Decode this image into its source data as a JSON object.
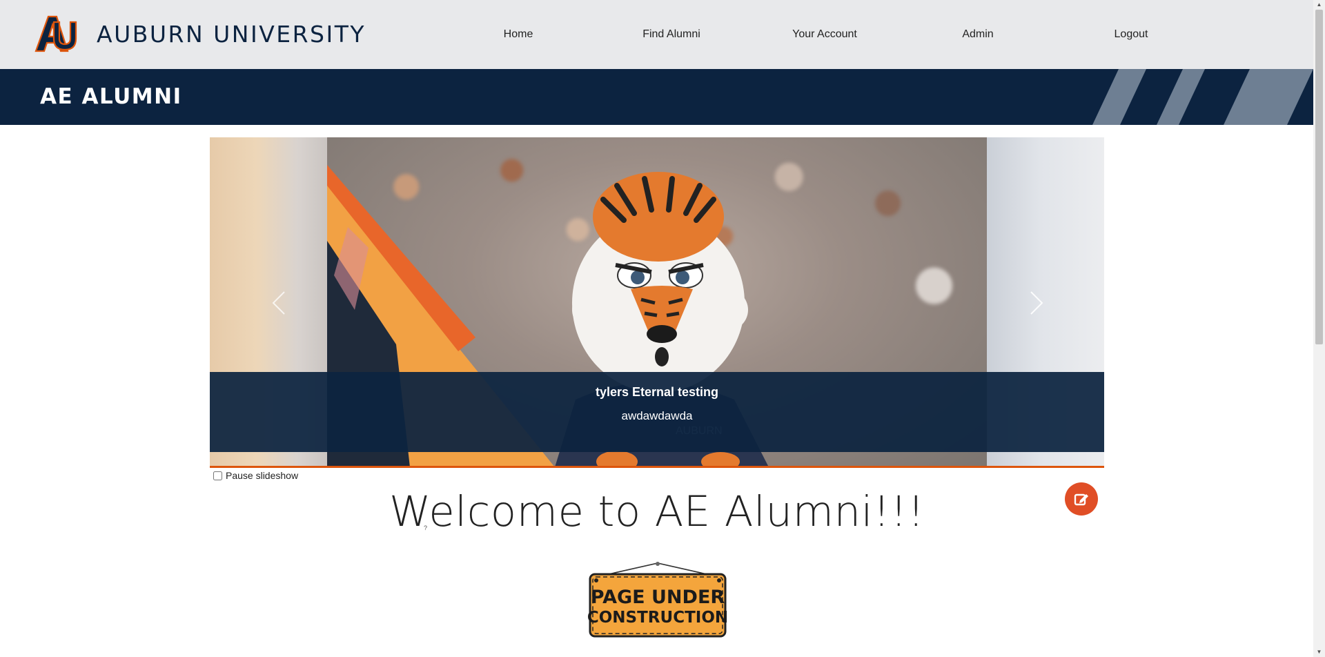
{
  "header": {
    "university_name": "AUBURN UNIVERSITY",
    "logo_icon": "au-logo-icon",
    "brand_colors": {
      "navy": "#0c2340",
      "orange": "#dd550c"
    },
    "nav": [
      {
        "label": "Home"
      },
      {
        "label": "Find Alumni"
      },
      {
        "label": "Your Account"
      },
      {
        "label": "Admin"
      },
      {
        "label": "Logout"
      }
    ]
  },
  "band": {
    "title": "AE ALUMNI"
  },
  "carousel": {
    "slide_title": "tylers Eternal testing",
    "slide_subtitle": "awdawdawda",
    "prev_icon": "chevron-left-icon",
    "next_icon": "chevron-right-icon",
    "pause_label": "Pause slideshow",
    "pause_checked": false
  },
  "main": {
    "heading": "Welcome to AE Alumni!!!",
    "help_mark": "?",
    "edit_icon": "edit-icon",
    "sign_text_line1": "PAGE UNDER",
    "sign_text_line2": "CONSTRUCTION"
  }
}
